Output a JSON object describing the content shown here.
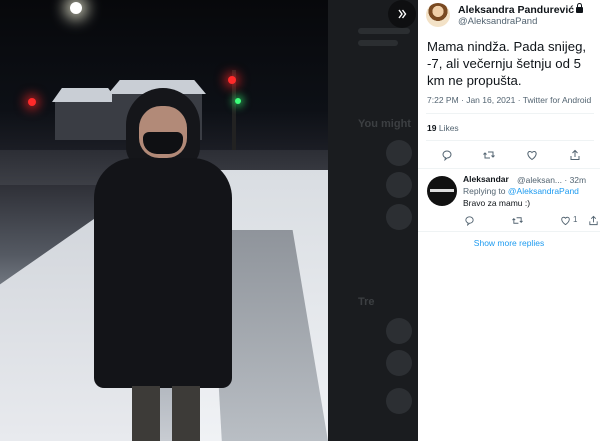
{
  "viewer": {
    "next_icon": "chevron-right-icon",
    "background_ghost": {
      "sidebar_title_1": "You might",
      "sidebar_title_2": "Tre"
    }
  },
  "tweet": {
    "author_name": "Aleksandra Pandurević",
    "author_handle": "@AleksandraPand",
    "protected_icon": "lock-icon",
    "text": "Mama nindža. Pada snijeg, -7, ali večernju šetnju od 5 km ne propušta.",
    "timestamp": "7:22 PM · Jan 16, 2021 · Twitter for Android",
    "likes_count": "19",
    "likes_label": "Likes",
    "actions": [
      "reply-icon",
      "retweet-icon",
      "like-icon",
      "share-icon"
    ]
  },
  "reply": {
    "author_name": "Aleksandar",
    "author_handle": "@aleksan... · 32m",
    "replying_prefix": "Replying to",
    "replying_to": "@AleksandraPand",
    "text": "Bravo za mamu :)",
    "like_count": "1",
    "actions": [
      "reply-icon",
      "retweet-icon",
      "like-icon",
      "share-icon"
    ]
  },
  "show_more_replies": "Show more replies",
  "colors": {
    "link_blue": "#1d9bf0",
    "text_primary": "#0f1419",
    "text_secondary": "#536471"
  }
}
